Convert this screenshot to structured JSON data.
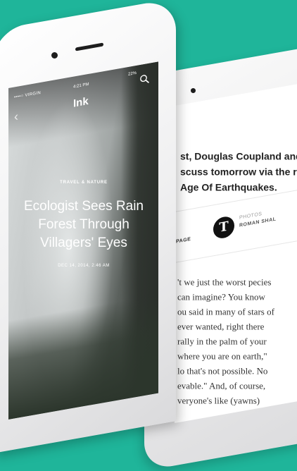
{
  "article_screen": {
    "carrier": "••••○ VIRGIN",
    "time": "4:21 PM",
    "battery": "22%",
    "app_logo": "Ink",
    "category": "TRAVEL & NATURE",
    "headline": "Ecologist Sees Rain Forest Through Villagers' Eyes",
    "date": "DEC 14, 2014, 2:46 AM",
    "back_icon": "chevron-left-icon",
    "search_icon": "search-icon"
  },
  "reader_screen": {
    "quote": "st, Douglas Coupland and scuss tomorrow via the r Age Of Earthquakes.",
    "page_label": "PAGE",
    "publisher_logo": "T",
    "photos_label": "PHOTOS",
    "photographer": "ROMAN SHAL",
    "body_lines": [
      "'t we just the worst pecies",
      "can imagine? You know",
      "ou said in many of stars of",
      "ever wanted, right there",
      "rally in the palm of your",
      "where you are on earth,\"",
      "lo that's not possible. No",
      "evable.\" And, of course,",
      "veryone's like (yawns)"
    ]
  }
}
